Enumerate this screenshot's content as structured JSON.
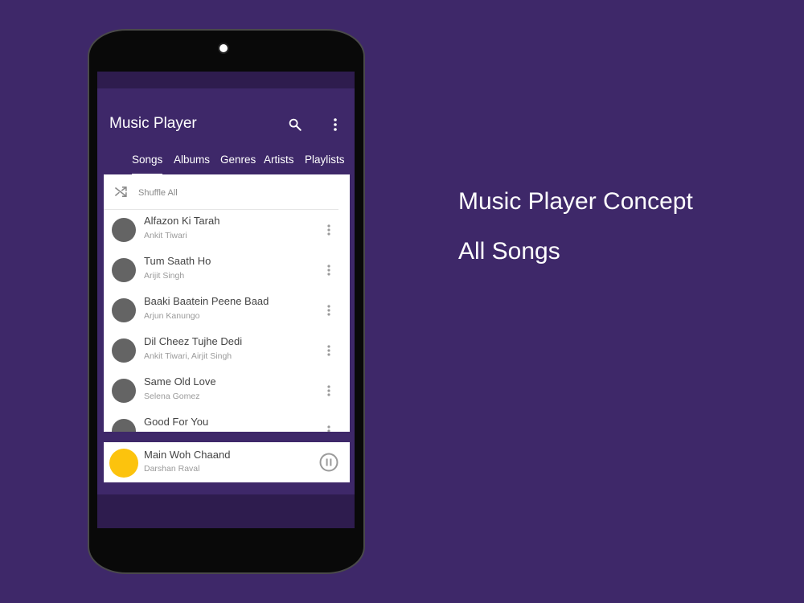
{
  "app": {
    "title": "Music Player",
    "tabs": [
      {
        "label": "Songs",
        "active": true
      },
      {
        "label": "Albums"
      },
      {
        "label": "Genres"
      },
      {
        "label": "Artists"
      },
      {
        "label": "Playlists"
      }
    ],
    "shuffle_label": "Shuffle All",
    "songs": [
      {
        "title": "Alfazon Ki Tarah",
        "artist": "Ankit Tiwari"
      },
      {
        "title": "Tum Saath Ho",
        "artist": "Arijit Singh"
      },
      {
        "title": "Baaki Baatein Peene Baad",
        "artist": "Arjun Kanungo"
      },
      {
        "title": "Dil Cheez Tujhe Dedi",
        "artist": "Ankit Tiwari, Airjit Singh"
      },
      {
        "title": "Same Old Love",
        "artist": "Selena Gomez"
      },
      {
        "title": "Good For You",
        "artist": ""
      }
    ],
    "now_playing": {
      "title": "Main Woh Chaand",
      "artist": "Darshan Raval"
    },
    "icons": {
      "search": "search-icon",
      "overflow": "more-vert-icon",
      "shuffle": "shuffle-icon",
      "pause": "pause-icon"
    }
  },
  "captions": {
    "line1": "Music Player Concept",
    "line2": "All Songs"
  },
  "colors": {
    "background": "#3e2869",
    "status_bar": "#2e1c4e",
    "avatar": "#646464",
    "now_playing_avatar": "#fcc30d"
  }
}
